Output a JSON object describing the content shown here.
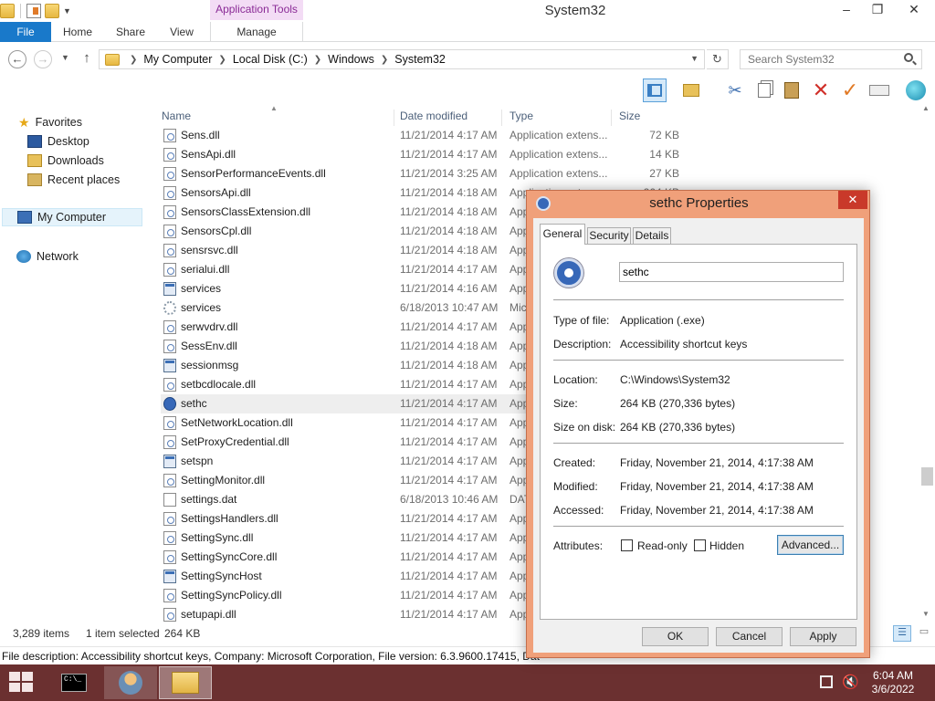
{
  "window": {
    "title": "System32"
  },
  "ribbon": {
    "context_group": "Application Tools",
    "tabs": {
      "file": "File",
      "home": "Home",
      "share": "Share",
      "view": "View",
      "manage": "Manage"
    }
  },
  "window_controls": {
    "minimize": "–",
    "maximize": "❐",
    "close": "✕"
  },
  "address": {
    "crumbs": [
      "My Computer",
      "Local Disk (C:)",
      "Windows",
      "System32"
    ],
    "search_placeholder": "Search System32"
  },
  "navigation": {
    "favorites": "Favorites",
    "desktop": "Desktop",
    "downloads": "Downloads",
    "recent_places": "Recent places",
    "my_computer": "My Computer",
    "network": "Network"
  },
  "columns": {
    "name": "Name",
    "date": "Date modified",
    "type": "Type",
    "size": "Size"
  },
  "files": [
    {
      "name": "Sens.dll",
      "date": "11/21/2014 4:17 AM",
      "type": "Application extens...",
      "size": "72 KB",
      "icon": "dll"
    },
    {
      "name": "SensApi.dll",
      "date": "11/21/2014 4:17 AM",
      "type": "Application extens...",
      "size": "14 KB",
      "icon": "dll"
    },
    {
      "name": "SensorPerformanceEvents.dll",
      "date": "11/21/2014 3:25 AM",
      "type": "Application extens...",
      "size": "27 KB",
      "icon": "dll"
    },
    {
      "name": "SensorsApi.dll",
      "date": "11/21/2014 4:18 AM",
      "type": "Application extens...",
      "size": "264 KB",
      "icon": "dll"
    },
    {
      "name": "SensorsClassExtension.dll",
      "date": "11/21/2014 4:18 AM",
      "type": "App",
      "size": "",
      "icon": "dll"
    },
    {
      "name": "SensorsCpl.dll",
      "date": "11/21/2014 4:18 AM",
      "type": "App",
      "size": "",
      "icon": "dll"
    },
    {
      "name": "sensrsvc.dll",
      "date": "11/21/2014 4:18 AM",
      "type": "App",
      "size": "",
      "icon": "dll"
    },
    {
      "name": "serialui.dll",
      "date": "11/21/2014 4:17 AM",
      "type": "App",
      "size": "",
      "icon": "dll"
    },
    {
      "name": "services",
      "date": "11/21/2014 4:16 AM",
      "type": "App",
      "size": "",
      "icon": "exe"
    },
    {
      "name": "services",
      "date": "6/18/2013 10:47 AM",
      "type": "Mic",
      "size": "",
      "icon": "gear"
    },
    {
      "name": "serwvdrv.dll",
      "date": "11/21/2014 4:17 AM",
      "type": "App",
      "size": "",
      "icon": "dll"
    },
    {
      "name": "SessEnv.dll",
      "date": "11/21/2014 4:18 AM",
      "type": "App",
      "size": "",
      "icon": "dll"
    },
    {
      "name": "sessionmsg",
      "date": "11/21/2014 4:18 AM",
      "type": "App",
      "size": "",
      "icon": "exe"
    },
    {
      "name": "setbcdlocale.dll",
      "date": "11/21/2014 4:17 AM",
      "type": "App",
      "size": "",
      "icon": "dll"
    },
    {
      "name": "sethc",
      "date": "11/21/2014 4:17 AM",
      "type": "App",
      "size": "",
      "icon": "access",
      "selected": true
    },
    {
      "name": "SetNetworkLocation.dll",
      "date": "11/21/2014 4:17 AM",
      "type": "App",
      "size": "",
      "icon": "dll"
    },
    {
      "name": "SetProxyCredential.dll",
      "date": "11/21/2014 4:17 AM",
      "type": "App",
      "size": "",
      "icon": "dll"
    },
    {
      "name": "setspn",
      "date": "11/21/2014 4:17 AM",
      "type": "App",
      "size": "",
      "icon": "exe"
    },
    {
      "name": "SettingMonitor.dll",
      "date": "11/21/2014 4:17 AM",
      "type": "App",
      "size": "",
      "icon": "dll"
    },
    {
      "name": "settings.dat",
      "date": "6/18/2013 10:46 AM",
      "type": "DAT",
      "size": "",
      "icon": "dat"
    },
    {
      "name": "SettingsHandlers.dll",
      "date": "11/21/2014 4:17 AM",
      "type": "App",
      "size": "",
      "icon": "dll"
    },
    {
      "name": "SettingSync.dll",
      "date": "11/21/2014 4:17 AM",
      "type": "App",
      "size": "",
      "icon": "dll"
    },
    {
      "name": "SettingSyncCore.dll",
      "date": "11/21/2014 4:17 AM",
      "type": "App",
      "size": "",
      "icon": "dll"
    },
    {
      "name": "SettingSyncHost",
      "date": "11/21/2014 4:17 AM",
      "type": "App",
      "size": "",
      "icon": "exe"
    },
    {
      "name": "SettingSyncPolicy.dll",
      "date": "11/21/2014 4:17 AM",
      "type": "App",
      "size": "",
      "icon": "dll"
    },
    {
      "name": "setupapi.dll",
      "date": "11/21/2014 4:17 AM",
      "type": "App",
      "size": "",
      "icon": "dll"
    }
  ],
  "status": {
    "count": "3,289 items",
    "selected": "1 item selected",
    "size": "264 KB"
  },
  "description_bar": "File description: Accessibility shortcut keys, Company: Microsoft Corporation, File version: 6.3.9600.17415, Dat",
  "dialog": {
    "title": "sethc Properties",
    "close": "✕",
    "tabs": {
      "general": "General",
      "security": "Security",
      "details": "Details"
    },
    "name_value": "sethc",
    "labels": {
      "type": "Type of file:",
      "description": "Description:",
      "location": "Location:",
      "size": "Size:",
      "size_on_disk": "Size on disk:",
      "created": "Created:",
      "modified": "Modified:",
      "accessed": "Accessed:",
      "attributes": "Attributes:"
    },
    "values": {
      "type": "Application (.exe)",
      "description": "Accessibility shortcut keys",
      "location": "C:\\Windows\\System32",
      "size": "264 KB (270,336 bytes)",
      "size_on_disk": "264 KB (270,336 bytes)",
      "created": "Friday, November 21, 2014, 4:17:38 AM",
      "modified": "Friday, November 21, 2014, 4:17:38 AM",
      "accessed": "Friday, November 21, 2014, 4:17:38 AM"
    },
    "attributes": {
      "readonly": "Read-only",
      "hidden": "Hidden",
      "advanced": "Advanced..."
    },
    "buttons": {
      "ok": "OK",
      "cancel": "Cancel",
      "apply": "Apply"
    }
  },
  "taskbar": {
    "cmd_text": "C:\\_",
    "time": "6:04 AM",
    "date": "3/6/2022"
  }
}
